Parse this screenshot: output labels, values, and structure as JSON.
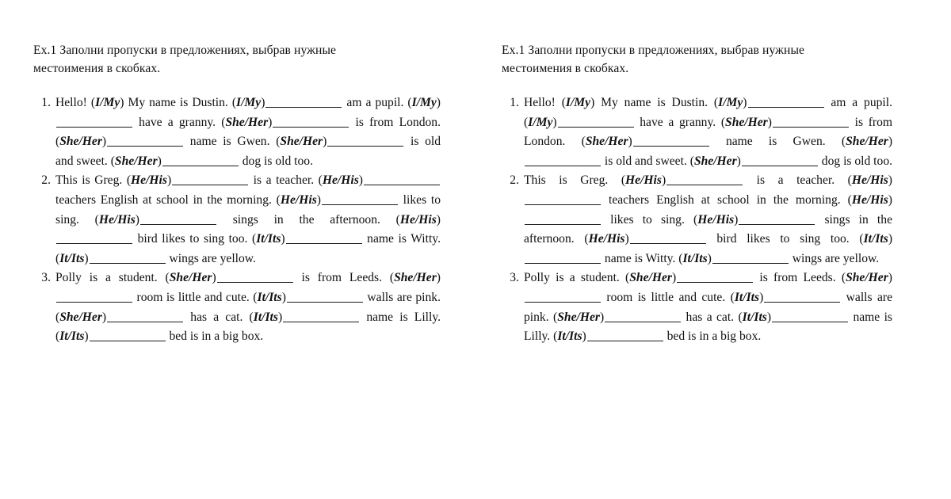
{
  "worksheet": {
    "heading": "Ex.1 Заполни пропуски в предложениях, выбрав нужные местоимения в скобках.",
    "markers": [
      "1.",
      "2.",
      "3."
    ],
    "open_paren": "(",
    "close_paren": ")",
    "text_color": "#111111",
    "background_color": "#ffffff",
    "blank_glyph": "__________"
  },
  "exercises": [
    {
      "number": "1.",
      "segments": [
        {
          "type": "text",
          "value": "Hello! "
        },
        {
          "type": "pronoun",
          "value": "I/My"
        },
        {
          "type": "text",
          "value": " My name is Dustin. "
        },
        {
          "type": "pronoun",
          "value": "I/My"
        },
        {
          "type": "blank"
        },
        {
          "type": "text",
          "value": " am a pupil. "
        },
        {
          "type": "pronoun",
          "value": "I/My"
        },
        {
          "type": "blank"
        },
        {
          "type": "text",
          "value": " have a granny. "
        },
        {
          "type": "pronoun",
          "value": "She/Her"
        },
        {
          "type": "blank"
        },
        {
          "type": "text",
          "value": " is from London. "
        },
        {
          "type": "pronoun",
          "value": "She/Her"
        },
        {
          "type": "blank"
        },
        {
          "type": "text",
          "value": " name is Gwen. "
        },
        {
          "type": "pronoun",
          "value": "She/Her"
        },
        {
          "type": "blank"
        },
        {
          "type": "text",
          "value": " is old and sweet. "
        },
        {
          "type": "pronoun",
          "value": "She/Her"
        },
        {
          "type": "blank"
        },
        {
          "type": "text",
          "value": " dog is old too."
        }
      ]
    },
    {
      "number": "2.",
      "segments": [
        {
          "type": "text",
          "value": "This is Greg. "
        },
        {
          "type": "pronoun",
          "value": "He/His"
        },
        {
          "type": "blank"
        },
        {
          "type": "text",
          "value": " is a teacher. "
        },
        {
          "type": "pronoun",
          "value": "He/His"
        },
        {
          "type": "blank"
        },
        {
          "type": "text",
          "value": " teachers English at school in the morning. "
        },
        {
          "type": "pronoun",
          "value": "He/His"
        },
        {
          "type": "blank"
        },
        {
          "type": "text",
          "value": " likes to sing. "
        },
        {
          "type": "pronoun",
          "value": "He/His"
        },
        {
          "type": "blank"
        },
        {
          "type": "text",
          "value": " sings in the afternoon. "
        },
        {
          "type": "pronoun",
          "value": "He/His"
        },
        {
          "type": "blank"
        },
        {
          "type": "text",
          "value": " bird likes to sing too. "
        },
        {
          "type": "pronoun",
          "value": "It/Its"
        },
        {
          "type": "blank"
        },
        {
          "type": "text",
          "value": " name is Witty. "
        },
        {
          "type": "pronoun",
          "value": "It/Its"
        },
        {
          "type": "blank"
        },
        {
          "type": "text",
          "value": " wings are yellow."
        }
      ]
    },
    {
      "number": "3.",
      "segments": [
        {
          "type": "text",
          "value": "Polly is a student. "
        },
        {
          "type": "pronoun",
          "value": "She/Her"
        },
        {
          "type": "blank"
        },
        {
          "type": "text",
          "value": " is from Leeds. "
        },
        {
          "type": "pronoun",
          "value": "She/Her"
        },
        {
          "type": "blank"
        },
        {
          "type": "text",
          "value": " room is little and cute. "
        },
        {
          "type": "pronoun",
          "value": "It/Its"
        },
        {
          "type": "blank"
        },
        {
          "type": "text",
          "value": " walls are pink. "
        },
        {
          "type": "pronoun",
          "value": "She/Her"
        },
        {
          "type": "blank"
        },
        {
          "type": "text",
          "value": " has a cat. "
        },
        {
          "type": "pronoun",
          "value": "It/Its"
        },
        {
          "type": "blank"
        },
        {
          "type": "text",
          "value": " name is Lilly. "
        },
        {
          "type": "pronoun",
          "value": "It/Its"
        },
        {
          "type": "blank"
        },
        {
          "type": "text",
          "value": " bed is in a big box."
        }
      ]
    }
  ],
  "columns": [
    {
      "id": "left",
      "name": "left-column"
    },
    {
      "id": "right",
      "name": "right-column"
    }
  ]
}
